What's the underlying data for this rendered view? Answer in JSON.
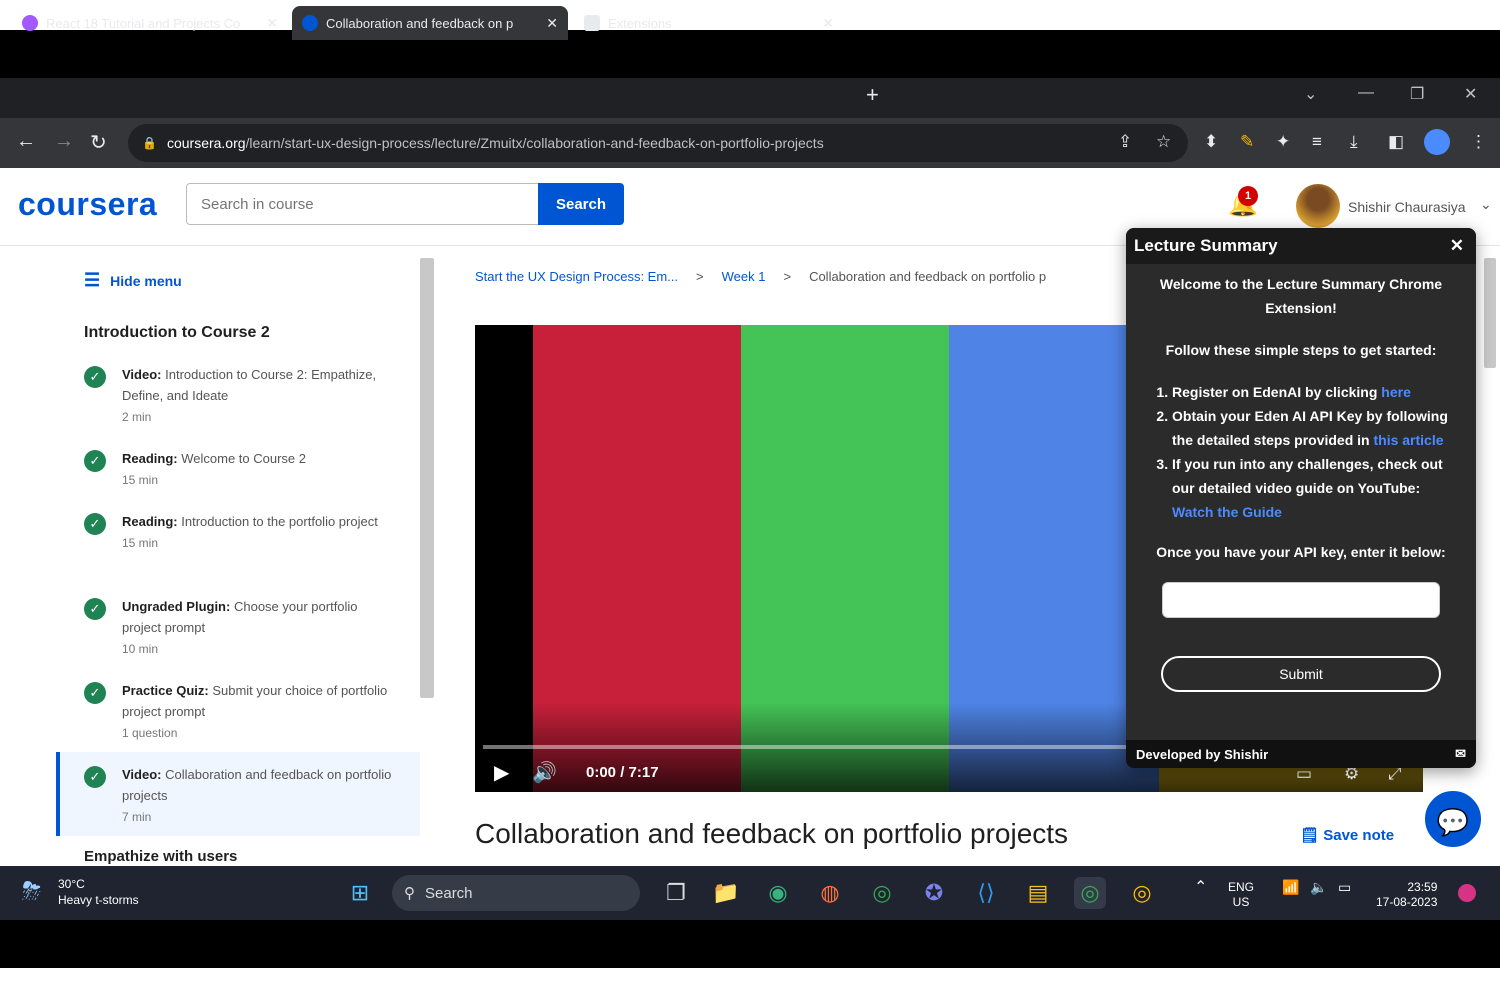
{
  "browser": {
    "tabs": [
      {
        "title": "React 18 Tutorial and Projects Co",
        "favicon_color": "#a259ff"
      },
      {
        "title": "Collaboration and feedback on p",
        "favicon_color": "#0056d2"
      },
      {
        "title": "Extensions",
        "favicon_color": "#e8eaed"
      }
    ],
    "url_host": "coursera.org",
    "url_path": "/learn/start-ux-design-process/lecture/Zmuitx/collaboration-and-feedback-on-portfolio-projects"
  },
  "header": {
    "logo": "coursera",
    "search_placeholder": "Search in course",
    "search_button": "Search",
    "notification_count": "1",
    "user_name": "Shishir Chaurasiya"
  },
  "sidebar": {
    "hide_menu": "Hide menu",
    "module_title": "Introduction to Course 2",
    "items": [
      {
        "kind": "Video:",
        "title": "Introduction to Course 2: Empathize, Define, and Ideate",
        "duration": "2 min"
      },
      {
        "kind": "Reading:",
        "title": "Welcome to Course 2",
        "duration": "15 min"
      },
      {
        "kind": "Reading:",
        "title": "Introduction to the portfolio project",
        "duration": "15 min"
      },
      {
        "kind": "Ungraded Plugin:",
        "title": "Choose your portfolio project prompt",
        "duration": "10 min"
      },
      {
        "kind": "Practice Quiz:",
        "title": "Submit your choice of portfolio project prompt",
        "duration": "1 question"
      },
      {
        "kind": "Video:",
        "title": "Collaboration and feedback on portfolio projects",
        "duration": "7 min"
      }
    ],
    "next_module": "Empathize with users"
  },
  "main": {
    "breadcrumb": [
      "Start the UX Design Process: Em...",
      "Week 1",
      "Collaboration and feedback on portfolio p"
    ],
    "video_time": "0:00",
    "video_duration": "7:17",
    "lecture_title": "Collaboration and feedback on portfolio projects",
    "save_note": "Save note"
  },
  "popup": {
    "title": "Lecture Summary",
    "welcome": "Welcome to the Lecture Summary Chrome Extension!",
    "intro": "Follow these simple steps to get started:",
    "step1": "Register on EdenAI by clicking ",
    "step1_link": "here",
    "step2": "Obtain your Eden AI API Key by following the detailed steps provided in ",
    "step2_link": "this article",
    "step3": "If you run into any challenges, check out our detailed video guide on YouTube: ",
    "step3_link": "Watch the Guide",
    "api_prompt": "Once you have your API key, enter it below:",
    "submit": "Submit",
    "footer": "Developed by Shishir"
  },
  "taskbar": {
    "weather_temp": "30°C",
    "weather_desc": "Heavy t-storms",
    "search": "Search",
    "lang": "ENG",
    "region": "US",
    "time": "23:59",
    "date": "17-08-2023"
  },
  "colors": {
    "accent": "#0056d2",
    "video_red": "#c8203a",
    "video_green": "#44c456",
    "video_blue": "#4f84e6"
  }
}
